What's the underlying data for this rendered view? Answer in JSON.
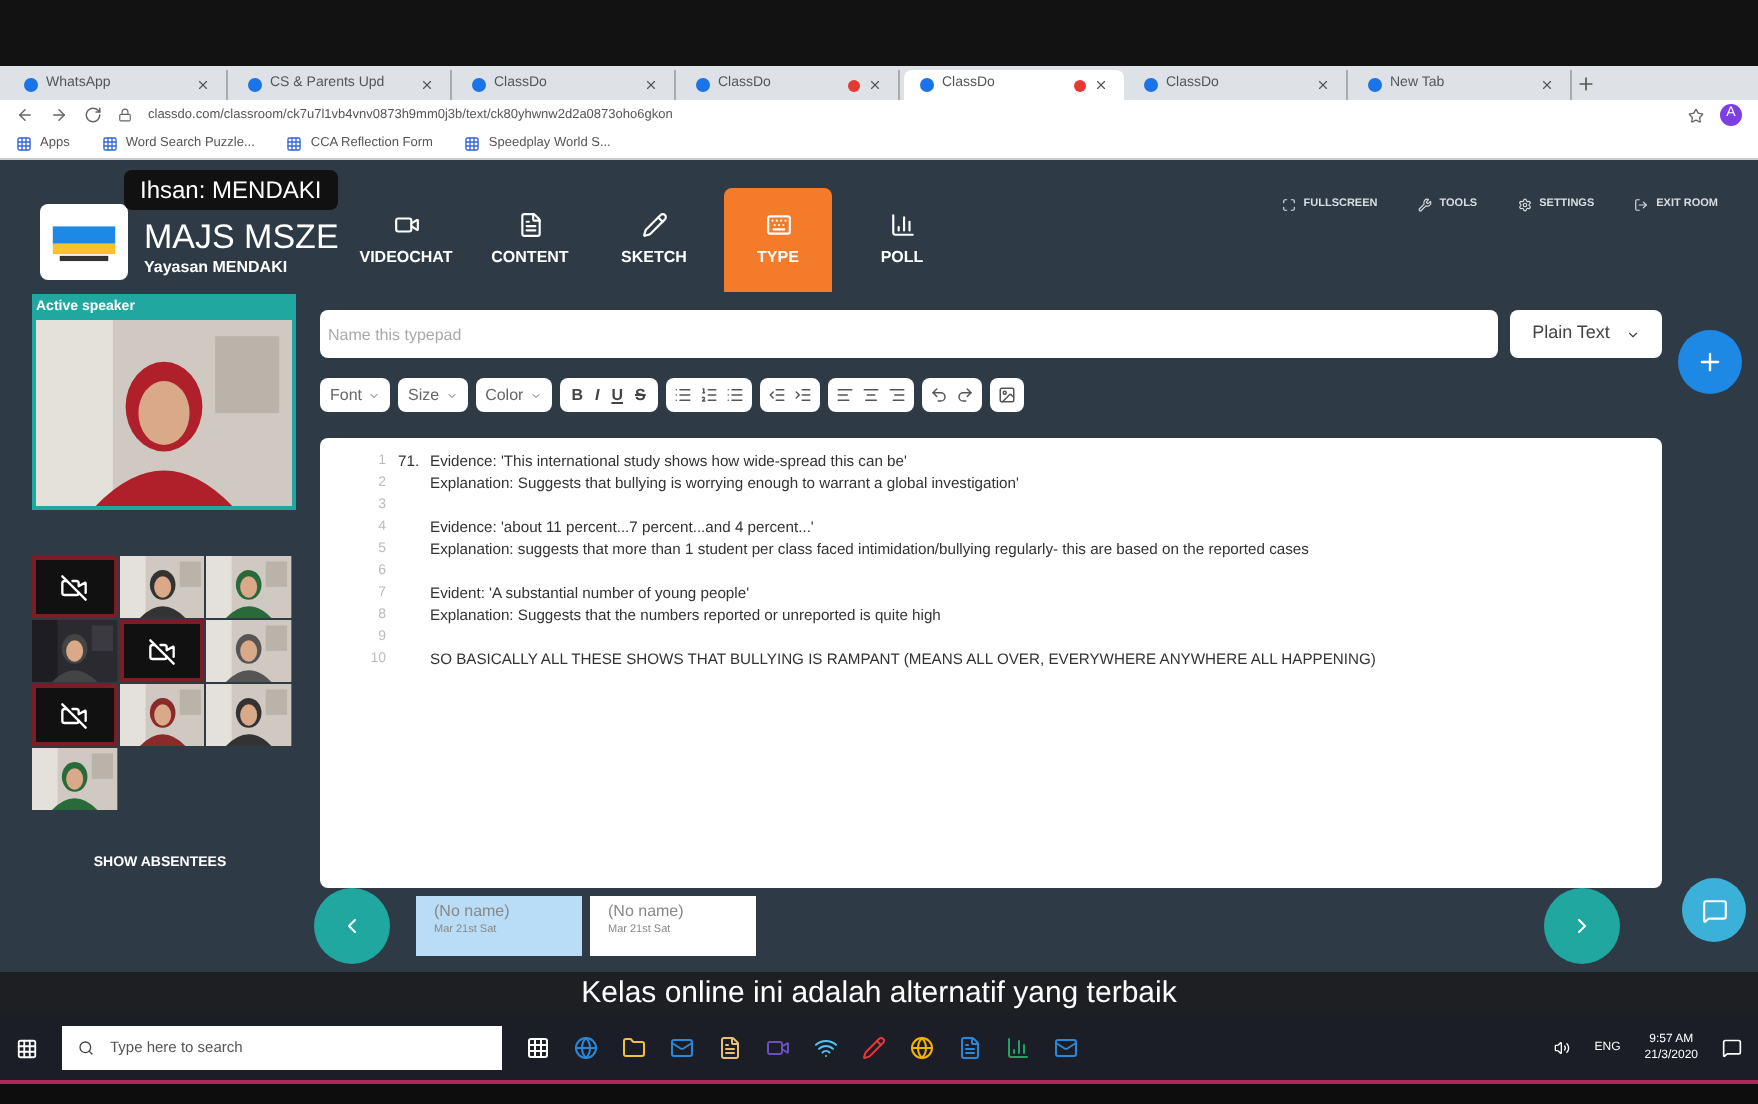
{
  "browser": {
    "tabs": [
      {
        "title": "WhatsApp",
        "selected": false,
        "recording": false
      },
      {
        "title": "CS & Parents Upd",
        "selected": false,
        "recording": false
      },
      {
        "title": "ClassDo",
        "selected": false,
        "recording": false
      },
      {
        "title": "ClassDo",
        "selected": false,
        "recording": true
      },
      {
        "title": "ClassDo",
        "selected": true,
        "recording": true
      },
      {
        "title": "ClassDo",
        "selected": false,
        "recording": false
      },
      {
        "title": "New Tab",
        "selected": false,
        "recording": false
      }
    ],
    "url": "classdo.com/classroom/ck7u7l1vb4vnv0873h9mm0j3b/text/ck80yhwnw2d2a0873oho6gkon",
    "profile": "A",
    "bookmarks": [
      "Apps",
      "Word Search Puzzle...",
      "CCA Reflection Form",
      "Speedplay World S..."
    ]
  },
  "speaker_tooltip": "Ihsan: MENDAKI",
  "header": {
    "title": "MAJS MSZE",
    "subtitle": "Yayasan MENDAKI",
    "nav": [
      {
        "label": "VIDEOCHAT",
        "kind": "video",
        "selected": false
      },
      {
        "label": "CONTENT",
        "kind": "file",
        "selected": false
      },
      {
        "label": "SKETCH",
        "kind": "pencil",
        "selected": false
      },
      {
        "label": "TYPE",
        "kind": "keyboard",
        "selected": true
      },
      {
        "label": "POLL",
        "kind": "chart",
        "selected": false
      }
    ],
    "actions": [
      {
        "label": "FULLSCREEN",
        "kind": "fullscreen"
      },
      {
        "label": "TOOLS",
        "kind": "wrench"
      },
      {
        "label": "SETTINGS",
        "kind": "gear"
      },
      {
        "label": "EXIT ROOM",
        "kind": "exit"
      }
    ]
  },
  "sidebar": {
    "active_speaker": "Active speaker",
    "tiles": [
      {
        "kind": "camera-off"
      },
      {
        "kind": "video"
      },
      {
        "kind": "video"
      },
      {
        "kind": "video"
      },
      {
        "kind": "camera-off"
      },
      {
        "kind": "video"
      },
      {
        "kind": "camera-off"
      },
      {
        "kind": "video"
      },
      {
        "kind": "video"
      },
      {
        "kind": "video"
      }
    ],
    "show_absentees": "SHOW ABSENTEES"
  },
  "typepad": {
    "name_placeholder": "Name this typepad",
    "format": "Plain Text",
    "dropdowns": [
      "Font",
      "Size",
      "Color"
    ],
    "format_buttons": [
      "B",
      "I",
      "U",
      "S"
    ],
    "lines": [
      {
        "number": "1",
        "marker": "71.",
        "text": "Evidence: 'This international study shows how wide-spread this can be'"
      },
      {
        "number": "2",
        "text": "Explanation: Suggests that bullying is worrying enough to warrant a global investigation'"
      },
      {
        "number": "3"
      },
      {
        "number": "4",
        "text": "Evidence: 'about 11 percent...7 percent...and 4 percent...'"
      },
      {
        "number": "5",
        "text": "Explanation: suggests that more than 1 student per class faced intimidation/bullying regularly- this are based on the reported cases"
      },
      {
        "number": "6"
      },
      {
        "number": "7",
        "text": "Evident: 'A substantial number of young people'"
      },
      {
        "number": "8",
        "text": "Explanation: Suggests that the numbers reported or unreported is quite high"
      },
      {
        "number": "9"
      },
      {
        "number": "10",
        "text": "SO BASICALLY ALL THESE SHOWS THAT BULLYING IS RAMPANT (MEANS ALL OVER, EVERYWHERE ANYWHERE ALL HAPPENING)"
      }
    ]
  },
  "pages": [
    {
      "name": "(No name)",
      "date": "Mar 21st Sat",
      "selected": true
    },
    {
      "name": "(No name)",
      "date": "Mar 21st Sat",
      "selected": false
    }
  ],
  "caption": "Kelas online ini adalah alternatif yang terbaik",
  "taskbar": {
    "search_placeholder": "Type here to search",
    "language": "ENG",
    "time": "9:57 AM",
    "date": "21/3/2020"
  }
}
